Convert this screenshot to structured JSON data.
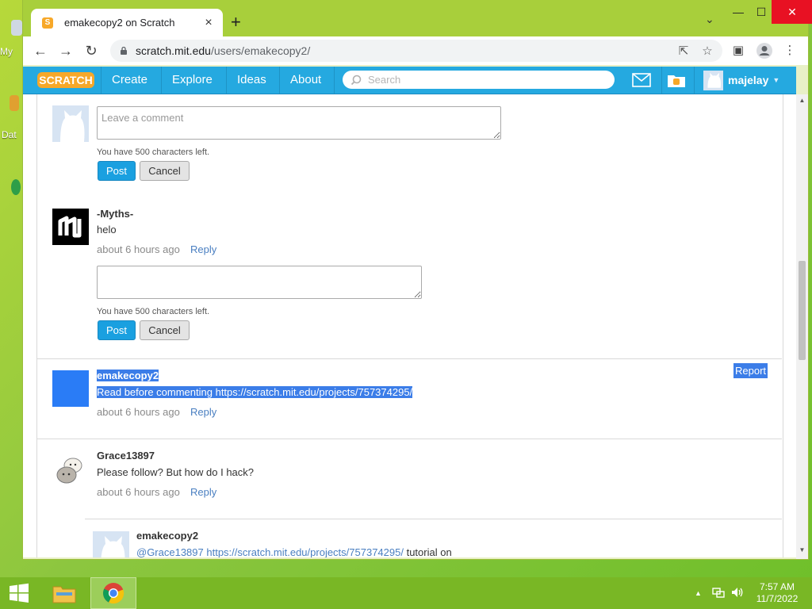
{
  "desktop": {
    "labels": [
      "My",
      "Dat"
    ]
  },
  "browser": {
    "tab": {
      "title": "emakecopy2 on Scratch",
      "favicon_letter": "S"
    },
    "address": {
      "host": "scratch.mit.edu",
      "path": "/users/emakecopy2/"
    },
    "window_controls": {
      "tab_list": "⌄",
      "minimize": "—",
      "maximize": "☐",
      "close": "✕"
    }
  },
  "scratch_nav": {
    "logo": "SCRATCH",
    "links": [
      "Create",
      "Explore",
      "Ideas",
      "About"
    ],
    "search_placeholder": "Search",
    "username": "majelay",
    "colors": {
      "bar": "#25a9e0",
      "logo_orange": "#f7a829"
    }
  },
  "comments": {
    "new_comment_placeholder": "Leave a comment",
    "chars_left": "You have 500 characters left.",
    "post_label": "Post",
    "cancel_label": "Cancel",
    "reply_label": "Reply",
    "report_label": "Report",
    "items": [
      {
        "author": "-Myths-",
        "text": "helo",
        "time": "about 6 hours ago"
      },
      {
        "author": "emakecopy2",
        "text": "Read before commenting https://scratch.mit.edu/projects/757374295/",
        "time": "about 6 hours ago"
      },
      {
        "author": "Grace13897",
        "text": "Please follow? But how do I hack?",
        "time": "about 6 hours ago"
      }
    ],
    "nested_reply": {
      "author": "emakecopy2",
      "mention": "@Grace13897",
      "link": "https://scratch.mit.edu/projects/757374295/",
      "text": "tutorial on"
    }
  },
  "taskbar": {
    "time": "7:57 AM",
    "date": "11/7/2022",
    "color": "#79b725"
  }
}
